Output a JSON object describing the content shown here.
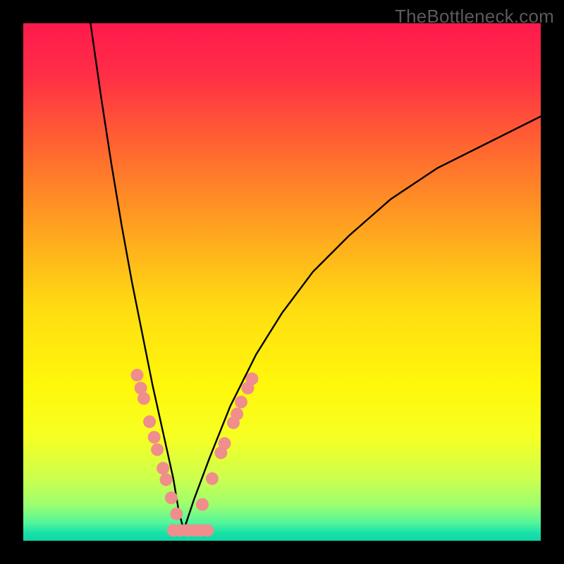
{
  "watermark": "TheBottleneck.com",
  "gradient_stops": [
    {
      "offset": 0.0,
      "color": "#ff1a4d"
    },
    {
      "offset": 0.1,
      "color": "#ff2e46"
    },
    {
      "offset": 0.25,
      "color": "#ff6a2f"
    },
    {
      "offset": 0.4,
      "color": "#ffa41f"
    },
    {
      "offset": 0.55,
      "color": "#ffdc12"
    },
    {
      "offset": 0.7,
      "color": "#fff80a"
    },
    {
      "offset": 0.8,
      "color": "#f6ff24"
    },
    {
      "offset": 0.88,
      "color": "#ccff4e"
    },
    {
      "offset": 0.93,
      "color": "#9dff6e"
    },
    {
      "offset": 0.965,
      "color": "#55f59a"
    },
    {
      "offset": 0.985,
      "color": "#18e2a8"
    },
    {
      "offset": 1.0,
      "color": "#0fd6a6"
    }
  ],
  "chart_data": {
    "type": "line",
    "title": "",
    "xlabel": "",
    "ylabel": "",
    "xlim": [
      0,
      100
    ],
    "ylim": [
      0,
      100
    ],
    "grid": false,
    "curve_description": "Asymmetric V-shaped bottleneck curve. Left branch descends steeply from top-left (x≈13,y=100) to the trough near x≈31,y≈2. Right branch ascends with a concave taper toward (x=100,y≈82). Salmon-colored data markers cluster along both branches between y≈10 and y≈32, and a flat row of markers sits at y≈2 across x≈29–35.",
    "series": [
      {
        "name": "left-branch",
        "x": [
          13,
          15,
          17,
          19,
          21,
          23,
          25,
          27,
          29,
          30,
          31
        ],
        "values": [
          100,
          86,
          73,
          61,
          50,
          40,
          30,
          21,
          12,
          6,
          2
        ]
      },
      {
        "name": "right-branch",
        "x": [
          31,
          33,
          36,
          40,
          45,
          50,
          56,
          63,
          71,
          80,
          90,
          100
        ],
        "values": [
          2,
          8,
          16,
          26,
          36,
          44,
          52,
          59,
          66,
          72,
          77,
          82
        ]
      }
    ],
    "markers": [
      {
        "x": 22.0,
        "y": 32.0
      },
      {
        "x": 22.7,
        "y": 29.5
      },
      {
        "x": 23.3,
        "y": 27.5
      },
      {
        "x": 24.4,
        "y": 23.0
      },
      {
        "x": 25.3,
        "y": 20.0
      },
      {
        "x": 25.9,
        "y": 17.6
      },
      {
        "x": 27.0,
        "y": 14.0
      },
      {
        "x": 27.6,
        "y": 11.8
      },
      {
        "x": 28.6,
        "y": 8.3
      },
      {
        "x": 29.6,
        "y": 5.2
      },
      {
        "x": 29.0,
        "y": 2.0
      },
      {
        "x": 30.3,
        "y": 2.0
      },
      {
        "x": 31.7,
        "y": 2.0
      },
      {
        "x": 33.0,
        "y": 2.0
      },
      {
        "x": 34.3,
        "y": 2.0
      },
      {
        "x": 35.6,
        "y": 2.0
      },
      {
        "x": 34.6,
        "y": 7.0
      },
      {
        "x": 36.5,
        "y": 12.0
      },
      {
        "x": 38.2,
        "y": 17.0
      },
      {
        "x": 38.9,
        "y": 18.8
      },
      {
        "x": 40.6,
        "y": 22.8
      },
      {
        "x": 41.3,
        "y": 24.5
      },
      {
        "x": 42.1,
        "y": 26.8
      },
      {
        "x": 43.4,
        "y": 29.5
      },
      {
        "x": 44.2,
        "y": 31.3
      }
    ],
    "marker_color": "#f08d8d",
    "marker_radius_px": 9
  }
}
